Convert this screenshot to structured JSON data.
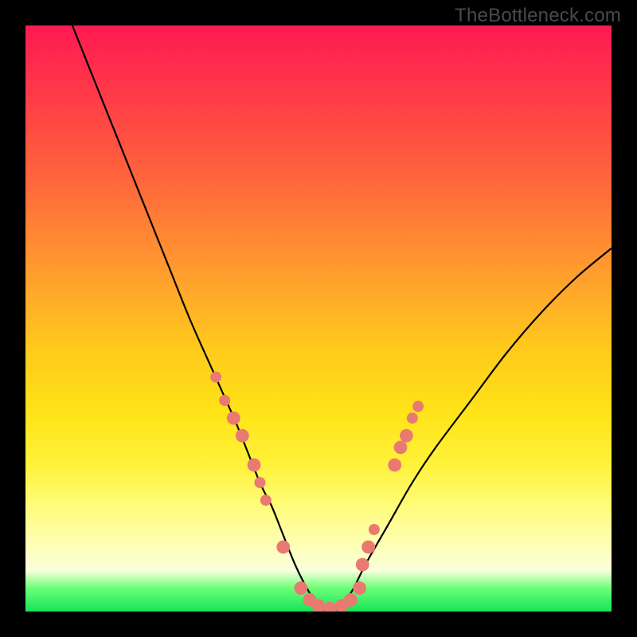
{
  "watermark": "TheBottleneck.com",
  "colors": {
    "frame": "#000000",
    "curve": "#000000",
    "marker": "#e97a72",
    "gradient_stops": [
      "#ff1a52",
      "#ff6b3a",
      "#ffc91c",
      "#fff23a",
      "#ffffb0",
      "#16e45a"
    ]
  },
  "chart_data": {
    "type": "line",
    "title": "",
    "xlabel": "",
    "ylabel": "",
    "xlim": [
      0,
      100
    ],
    "ylim": [
      0,
      100
    ],
    "grid": false,
    "legend": false,
    "series": [
      {
        "name": "bottleneck-curve",
        "x": [
          8,
          12,
          16,
          20,
          24,
          28,
          32,
          36,
          40,
          42,
          44,
          46,
          48,
          50,
          52,
          54,
          56,
          58,
          62,
          66,
          70,
          76,
          82,
          88,
          94,
          100
        ],
        "y": [
          100,
          90,
          80,
          70,
          60,
          50,
          41,
          32,
          22,
          18,
          13,
          8,
          4,
          1,
          0,
          1,
          4,
          8,
          15,
          22,
          28,
          36,
          44,
          51,
          57,
          62
        ]
      }
    ],
    "markers": [
      {
        "x": 32.5,
        "y": 40,
        "r": 1.0
      },
      {
        "x": 34.0,
        "y": 36,
        "r": 1.0
      },
      {
        "x": 35.5,
        "y": 33,
        "r": 1.2
      },
      {
        "x": 37.0,
        "y": 30,
        "r": 1.2
      },
      {
        "x": 39.0,
        "y": 25,
        "r": 1.2
      },
      {
        "x": 40.0,
        "y": 22,
        "r": 1.0
      },
      {
        "x": 41.0,
        "y": 19,
        "r": 1.0
      },
      {
        "x": 44.0,
        "y": 11,
        "r": 1.2
      },
      {
        "x": 47.0,
        "y": 4,
        "r": 1.2
      },
      {
        "x": 48.5,
        "y": 2,
        "r": 1.2
      },
      {
        "x": 50.0,
        "y": 1,
        "r": 1.2
      },
      {
        "x": 52.0,
        "y": 0.5,
        "r": 1.2
      },
      {
        "x": 54.0,
        "y": 1,
        "r": 1.2
      },
      {
        "x": 55.5,
        "y": 2,
        "r": 1.2
      },
      {
        "x": 57.0,
        "y": 4,
        "r": 1.2
      },
      {
        "x": 57.5,
        "y": 8,
        "r": 1.2
      },
      {
        "x": 58.5,
        "y": 11,
        "r": 1.2
      },
      {
        "x": 59.5,
        "y": 14,
        "r": 1.0
      },
      {
        "x": 63.0,
        "y": 25,
        "r": 1.2
      },
      {
        "x": 64.0,
        "y": 28,
        "r": 1.2
      },
      {
        "x": 65.0,
        "y": 30,
        "r": 1.2
      },
      {
        "x": 66.0,
        "y": 33,
        "r": 1.0
      },
      {
        "x": 67.0,
        "y": 35,
        "r": 1.0
      }
    ]
  }
}
